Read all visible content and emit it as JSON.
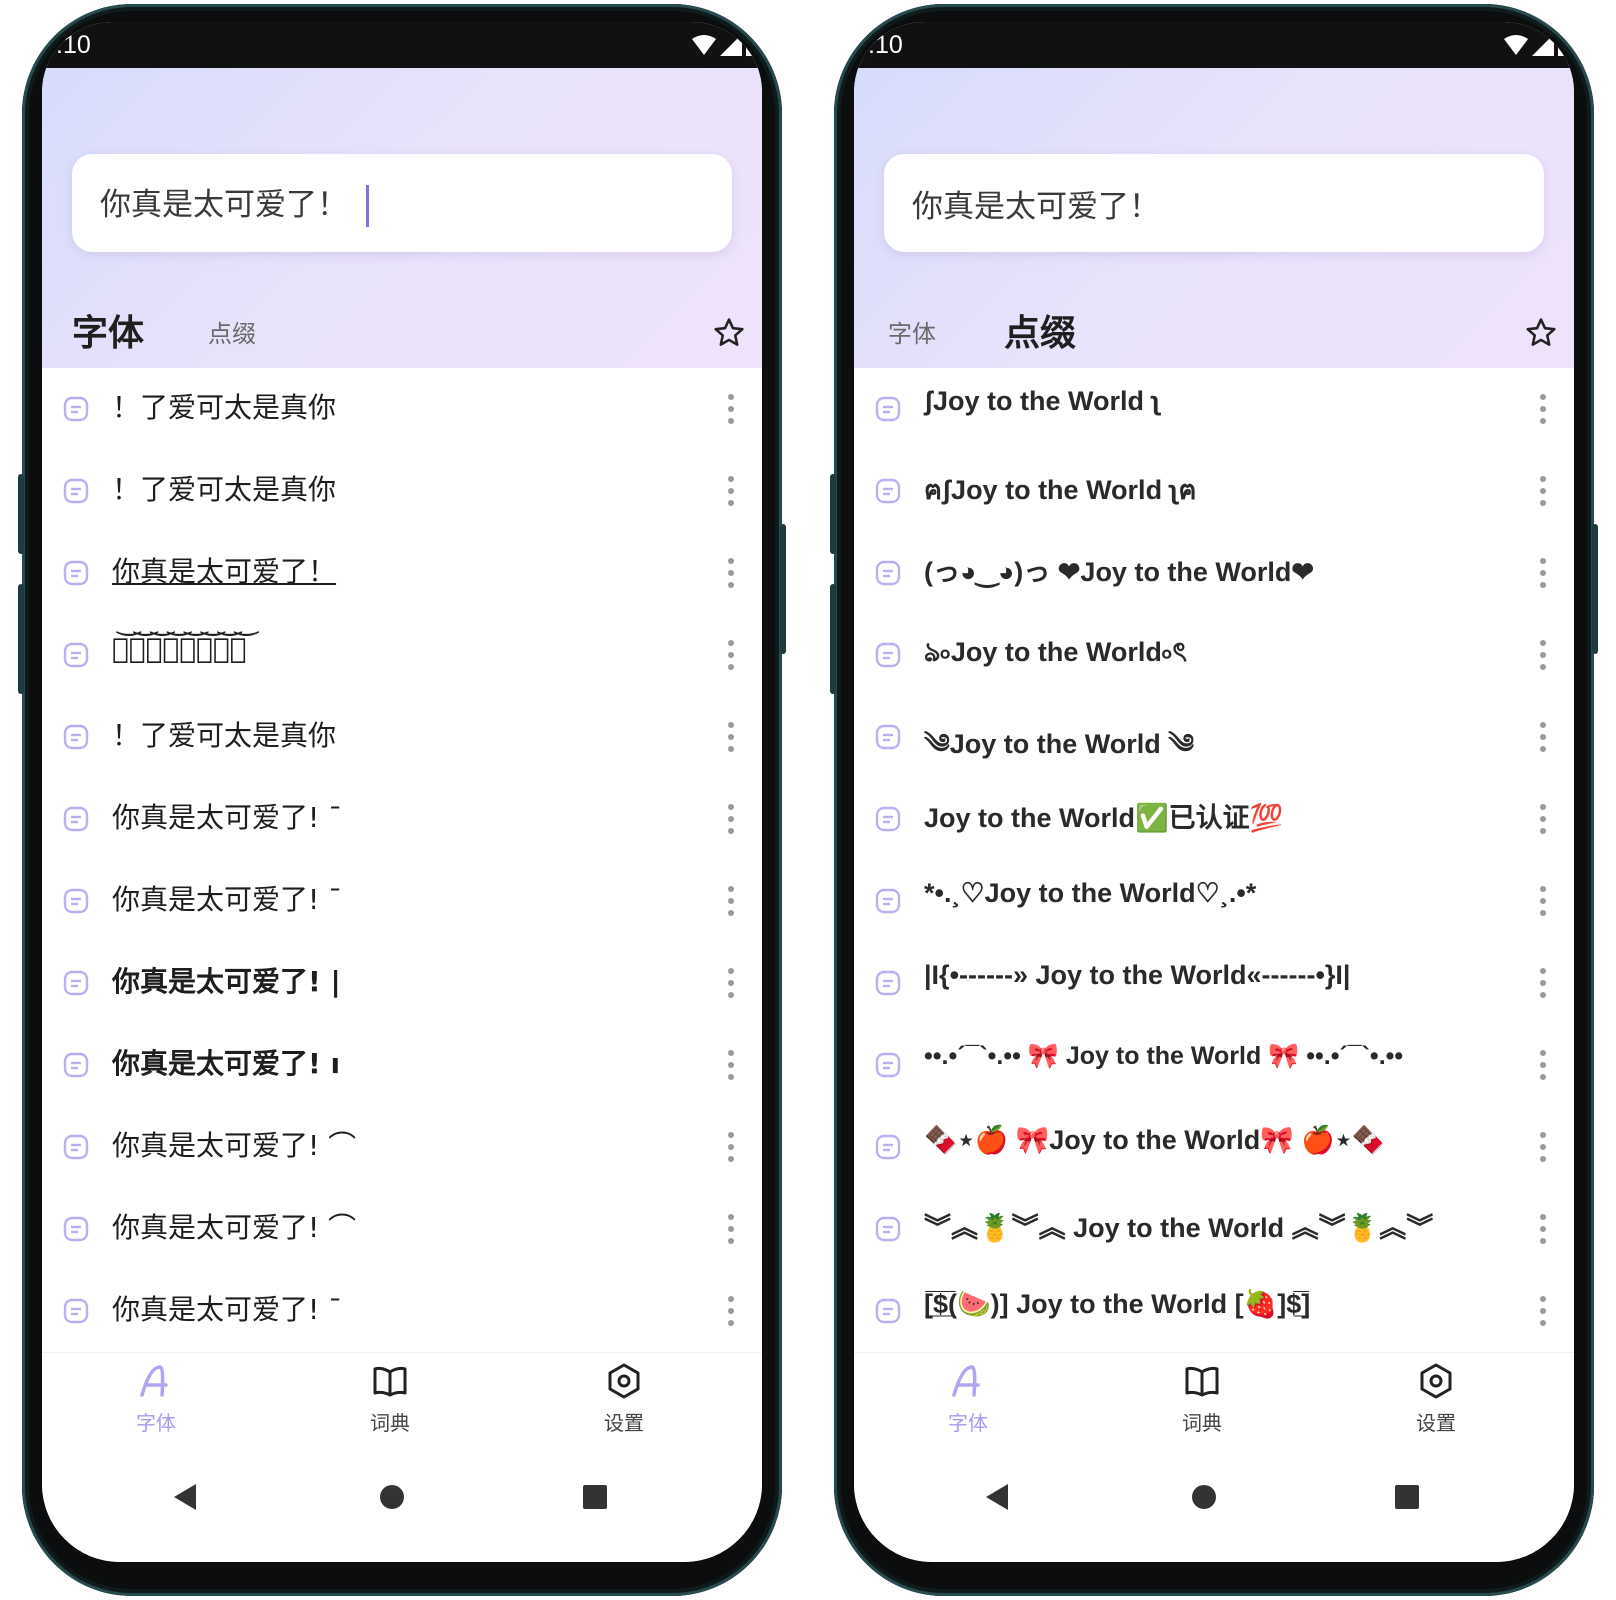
{
  "colors": {
    "accent": "#a59bf0",
    "header_from": "#d7dcfb",
    "header_to": "#efe3fb",
    "bezel": "#0b0d0e"
  },
  "screens": [
    {
      "status": {
        "time": ":10"
      },
      "input": {
        "value": "你真是太可爱了！"
      },
      "tabs": [
        {
          "label": "字体",
          "active": true
        },
        {
          "label": "点缀",
          "active": false
        }
      ],
      "rows": [
        "！了爱可太是真你",
        "！了爱可太是真你",
        "你真是太可爱了！",
        "你͝真͝是͝太͝可͝爱͝了͝！͝",
        "！了爱可太是真你",
        "你真是太可爱了! ˉ",
        "你真是太可爱了! ˉ",
        "你真是太可爱了! |",
        "你真是太可爱了! ı",
        "你真是太可爱了! ⌒",
        "你真是太可爱了! ⌒",
        "你真是太可爱了! ˉ"
      ]
    },
    {
      "status": {
        "time": ":10"
      },
      "input": {
        "value": "你真是太可爱了！"
      },
      "tabs": [
        {
          "label": "字体",
          "active": false
        },
        {
          "label": "点缀",
          "active": true
        }
      ],
      "rows": [
        "ʃJoy to the World ʅ",
        "ฅʃJoy to the World ʅฅ",
        "(っ◕‿◕)っ ❤Joy to the World❤",
        "ঌ৹Joy to the World৹ৎ",
        "༄Joy to the World ༄",
        "Joy to the World✅已认证💯",
        "*•.¸♡Joy to the World♡¸.•*",
        "|I{•------» Joy to the World«------•}I|",
        "••.•´¯`•.••  🎀 Joy to the World 🎀  ••.•´¯`•.••",
        "🍫⋆🍎 🎀Joy to the World🎀 🍎⋆🍫",
        "︾︽🍍︾︽ Joy to the World ︽︾🍍︽︾",
        "[̲̅$̲̅(🍉)] Joy to the World [🍓]$̲̅]"
      ]
    }
  ],
  "nav": [
    {
      "label": "字体",
      "icon": "font-a-icon",
      "active": true
    },
    {
      "label": "词典",
      "icon": "book-icon",
      "active": false
    },
    {
      "label": "设置",
      "icon": "settings-icon",
      "active": false
    }
  ]
}
